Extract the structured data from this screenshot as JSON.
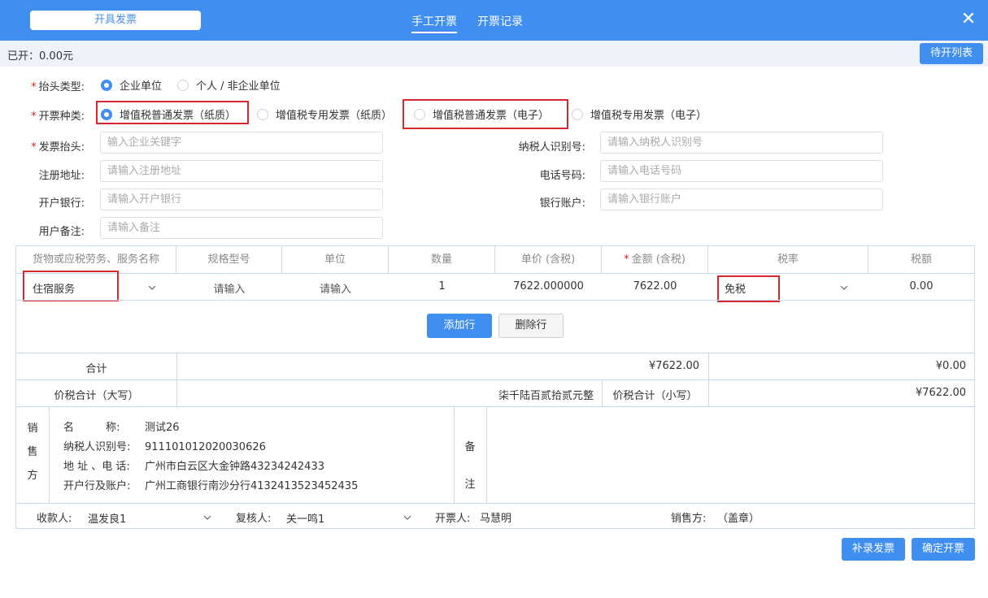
{
  "header": {
    "issue_button": "开具发票",
    "tabs": [
      {
        "label": "手工开票",
        "active": true
      },
      {
        "label": "开票记录",
        "active": false
      }
    ],
    "close": "✕"
  },
  "subbar": {
    "opened_label": "已开：",
    "opened_amount": "0.00元",
    "pending_button": "待开列表"
  },
  "form": {
    "title_type": {
      "label": "抬头类型:",
      "options": [
        "企业单位",
        "个人 / 非企业单位"
      ],
      "selected": "企业单位"
    },
    "invoice_type": {
      "label": "开票种类:",
      "options": [
        "增值税普通发票（纸质）",
        "增值税专用发票（纸质）",
        "增值税普通发票（电子）",
        "增值税专用发票（电子）"
      ],
      "selected": "增值税普通发票（纸质）"
    },
    "invoice_title": {
      "label": "发票抬头:",
      "placeholder": "输入企业关键字"
    },
    "tax_id": {
      "label": "纳税人识别号:",
      "placeholder": "请输入纳税人识别号"
    },
    "address": {
      "label": "注册地址:",
      "placeholder": "请输入注册地址"
    },
    "phone": {
      "label": "电话号码:",
      "placeholder": "请输入电话号码"
    },
    "bank": {
      "label": "开户银行:",
      "placeholder": "请输入开户银行"
    },
    "account": {
      "label": "银行账户:",
      "placeholder": "请输入银行账户"
    },
    "remark": {
      "label": "用户备注:",
      "placeholder": "请输入备注"
    },
    "required_mark": "*"
  },
  "table": {
    "headers": [
      "货物或应税劳务、服务名称",
      "规格型号",
      "单位",
      "数量",
      "单价 (含税)",
      "金额 (含税)",
      "税率",
      "税额"
    ],
    "required_mark": "*",
    "row": {
      "name": "住宿服务",
      "spec": "请输入",
      "unit": "请输入",
      "qty": "1",
      "price": "7622.000000",
      "amount": "7622.00",
      "tax_rate": "免税",
      "tax": "0.00"
    },
    "add_row": "添加行",
    "delete_row": "删除行",
    "total_label": "合计",
    "total_amount": "¥7622.00",
    "total_tax": "¥0.00",
    "sum_upper_label": "价税合计（大写）",
    "sum_upper_value": "柒千陆百贰拾贰元整",
    "sum_lower_label": "价税合计（小写）",
    "sum_lower_value": "¥7622.00"
  },
  "seller": {
    "side_label": [
      "销",
      "售",
      "方"
    ],
    "name_key": "名　　　称:",
    "name_value": "测试26",
    "taxid_key": "纳税人识别号:",
    "taxid_value": "911101012020030626",
    "addr_key": "地 址 、电 话:",
    "addr_value": "广州市白云区大金钟路43234242433",
    "bank_key": "开户行及账户:",
    "bank_value": "广州工商银行南沙分行4132413523452435",
    "remark_label": [
      "备",
      "注"
    ]
  },
  "footer_row": {
    "payee_label": "收款人:",
    "payee_value": "温发良1",
    "reviewer_label": "复核人:",
    "reviewer_value": "关一鸣1",
    "drawer_label": "开票人:",
    "drawer_value": "马慧明",
    "seller_label": "销售方:",
    "seller_value": "（盖章）"
  },
  "actions": {
    "supplement": "补录发票",
    "confirm": "确定开票"
  },
  "colors": {
    "primary": "#3f8ef0",
    "highlight": "#d8282f"
  }
}
